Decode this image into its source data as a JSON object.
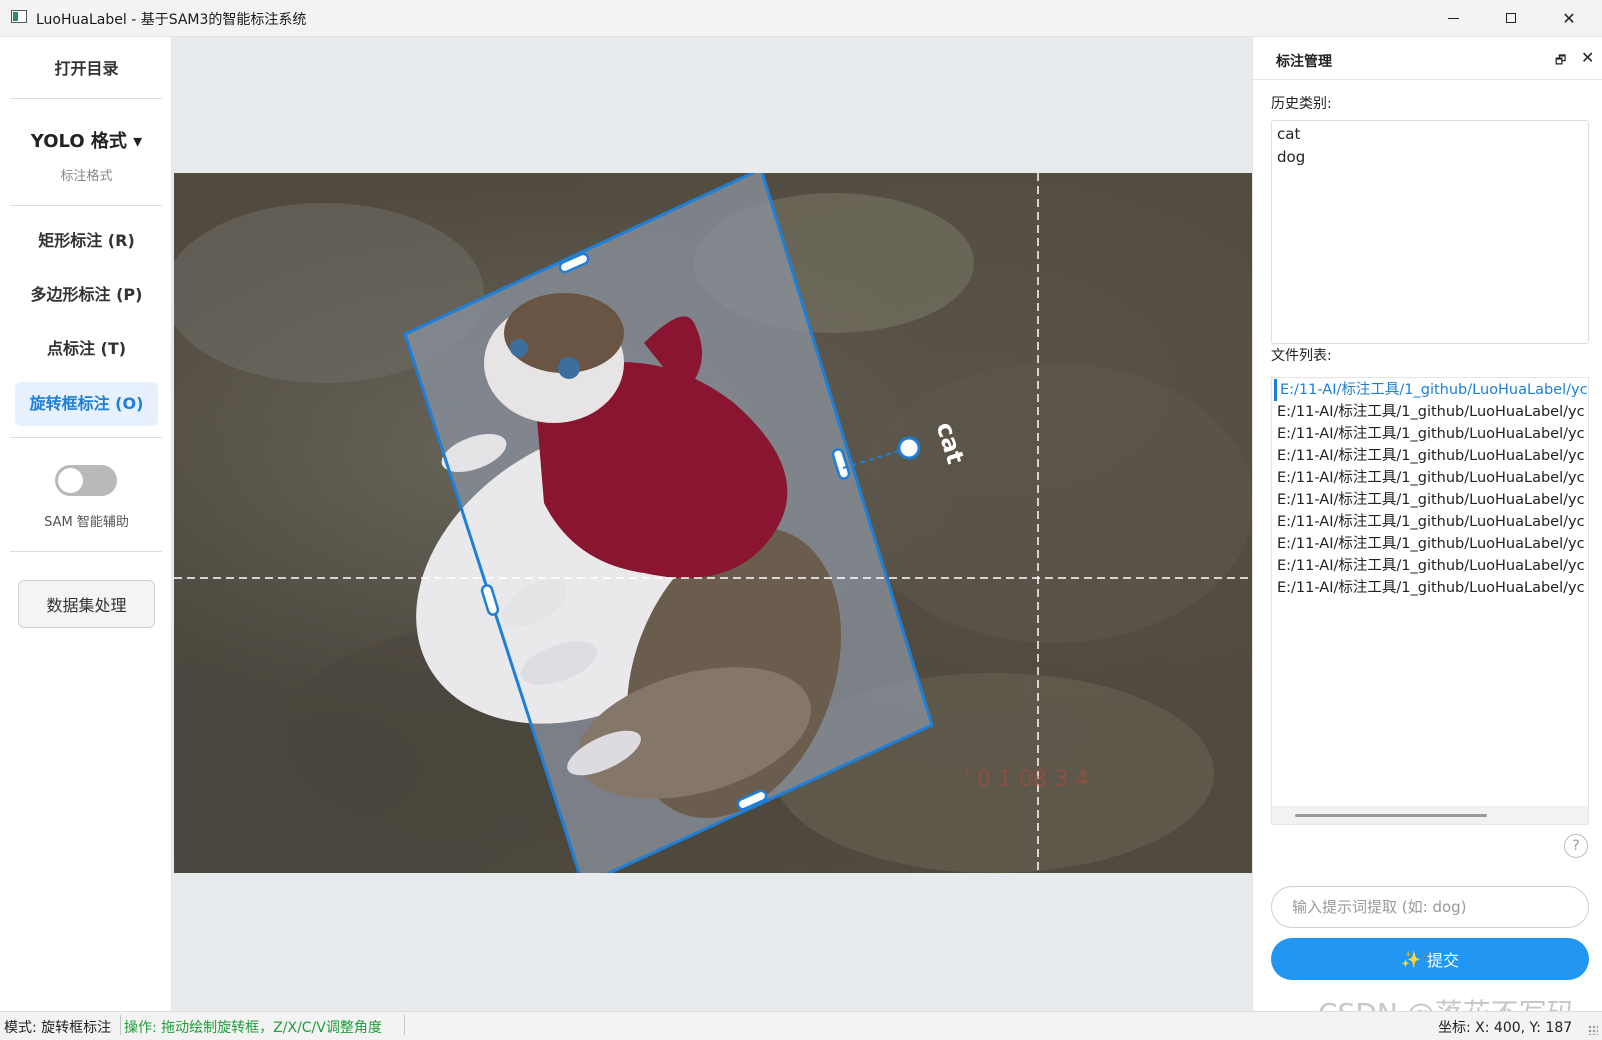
{
  "window": {
    "title": "LuoHuaLabel - 基于SAM3的智能标注系统",
    "minimize_glyph": "─",
    "close_glyph": "✕"
  },
  "sidebar": {
    "open_dir": "打开目录",
    "format_label": "YOLO 格式 ▾",
    "format_sub": "标注格式",
    "tools": [
      {
        "label": "矩形标注 (R)"
      },
      {
        "label": "多边形标注 (P)"
      },
      {
        "label": "点标注 (T)"
      },
      {
        "label": "旋转框标注 (O)"
      }
    ],
    "sam_toggle": {
      "label": "SAM 智能辅助",
      "on": false
    },
    "dataset_button": "数据集处理"
  },
  "canvas": {
    "annotation_label": "cat",
    "box_color": "#1e7fd8"
  },
  "panel": {
    "title": "标注管理",
    "restore_glyph": "🗗",
    "close_glyph": "✕",
    "history_label": "历史类别:",
    "history": [
      "cat",
      "dog"
    ],
    "files_label": "文件列表:",
    "files": [
      "E:/11-AI/标注工具/1_github/LuoHuaLabel/yc",
      "E:/11-AI/标注工具/1_github/LuoHuaLabel/yc",
      "E:/11-AI/标注工具/1_github/LuoHuaLabel/yc",
      "E:/11-AI/标注工具/1_github/LuoHuaLabel/yc",
      "E:/11-AI/标注工具/1_github/LuoHuaLabel/yc",
      "E:/11-AI/标注工具/1_github/LuoHuaLabel/yc",
      "E:/11-AI/标注工具/1_github/LuoHuaLabel/yc",
      "E:/11-AI/标注工具/1_github/LuoHuaLabel/yc",
      "E:/11-AI/标注工具/1_github/LuoHuaLabel/yc",
      "E:/11-AI/标注工具/1_github/LuoHuaLabel/yc"
    ],
    "help_glyph": "?",
    "prompt_placeholder": "输入提示词提取 (如: dog)",
    "submit_icon": "✨",
    "submit_label": "提交",
    "watermark": "CSDN @落花不写码"
  },
  "status": {
    "mode": "模式: 旋转框标注",
    "operation": "操作: 拖动绘制旋转框，Z/X/C/V调整角度",
    "coords": "坐标: X: 400, Y: 187"
  }
}
